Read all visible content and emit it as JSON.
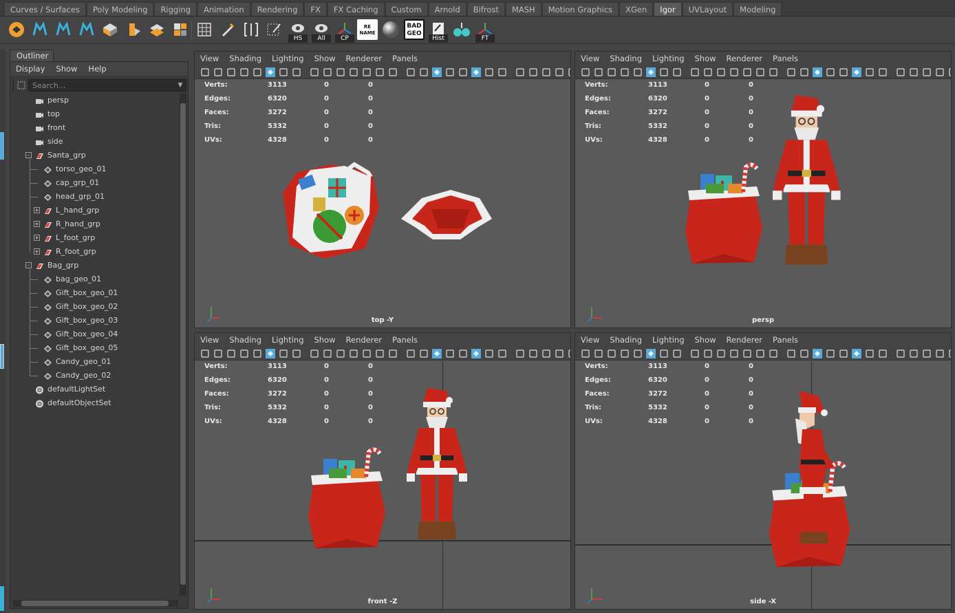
{
  "shelf": {
    "tabs": [
      "Curves / Surfaces",
      "Poly Modeling",
      "Rigging",
      "Animation",
      "Rendering",
      "FX",
      "FX Caching",
      "Custom",
      "Arnold",
      "Bifrost",
      "MASH",
      "Motion Graphics",
      "XGen",
      "Igor",
      "UVLayout",
      "Modeling"
    ],
    "active_tab": "Igor",
    "icon_labels": {
      "hs": "HS",
      "all": "All",
      "cp": "CP",
      "rename": "RE NAME",
      "badgeo": "BAD GEO",
      "hist": "Hist",
      "ft": "FT"
    }
  },
  "outliner": {
    "tab_label": "Outliner",
    "menu": [
      "Display",
      "Show",
      "Help"
    ],
    "search_placeholder": "Search...",
    "items": [
      {
        "label": "persp",
        "icon": "camera-icon"
      },
      {
        "label": "top",
        "icon": "camera-icon"
      },
      {
        "label": "front",
        "icon": "camera-icon"
      },
      {
        "label": "side",
        "icon": "camera-icon"
      },
      {
        "label": "Santa_grp",
        "icon": "group-icon"
      },
      {
        "label": "torso_geo_01",
        "icon": "mesh-icon"
      },
      {
        "label": "cap_grp_01",
        "icon": "mesh-icon"
      },
      {
        "label": "head_grp_01",
        "icon": "mesh-icon"
      },
      {
        "label": "L_hand_grp",
        "icon": "group-icon"
      },
      {
        "label": "R_hand_grp",
        "icon": "group-icon"
      },
      {
        "label": "L_foot_grp",
        "icon": "group-icon"
      },
      {
        "label": "R_foot_grp",
        "icon": "group-icon"
      },
      {
        "label": "Bag_grp",
        "icon": "group-icon"
      },
      {
        "label": "bag_geo_01",
        "icon": "mesh-icon"
      },
      {
        "label": "Gift_box_geo_01",
        "icon": "mesh-icon"
      },
      {
        "label": "Gift_box_geo_02",
        "icon": "mesh-icon"
      },
      {
        "label": "Gift_box_geo_03",
        "icon": "mesh-icon"
      },
      {
        "label": "Gift_box_geo_04",
        "icon": "mesh-icon"
      },
      {
        "label": "Gift_box_geo_05",
        "icon": "mesh-icon"
      },
      {
        "label": "Candy_geo_01",
        "icon": "mesh-icon"
      },
      {
        "label": "Candy_geo_02",
        "icon": "mesh-icon"
      },
      {
        "label": "defaultLightSet",
        "icon": "set-icon"
      },
      {
        "label": "defaultObjectSet",
        "icon": "set-icon"
      }
    ]
  },
  "panel_menu": [
    "View",
    "Shading",
    "Lighting",
    "Show",
    "Renderer",
    "Panels"
  ],
  "hud": [
    {
      "label": "Verts:",
      "v1": "3113",
      "v2": "0",
      "v3": "0"
    },
    {
      "label": "Edges:",
      "v1": "6320",
      "v2": "0",
      "v3": "0"
    },
    {
      "label": "Faces:",
      "v1": "3272",
      "v2": "0",
      "v3": "0"
    },
    {
      "label": "Tris:",
      "v1": "5332",
      "v2": "0",
      "v3": "0"
    },
    {
      "label": "UVs:",
      "v1": "4328",
      "v2": "0",
      "v3": "0"
    }
  ],
  "viewports": [
    {
      "camera": "top -Y"
    },
    {
      "camera": "persp"
    },
    {
      "camera": "front -Z"
    },
    {
      "camera": "side -X"
    }
  ],
  "colors": {
    "santa_red": "#c8251b",
    "fur_white": "#e8e8e8",
    "accent_blue": "#5bb5e8",
    "viewport_bg": "#5a5a5a"
  }
}
